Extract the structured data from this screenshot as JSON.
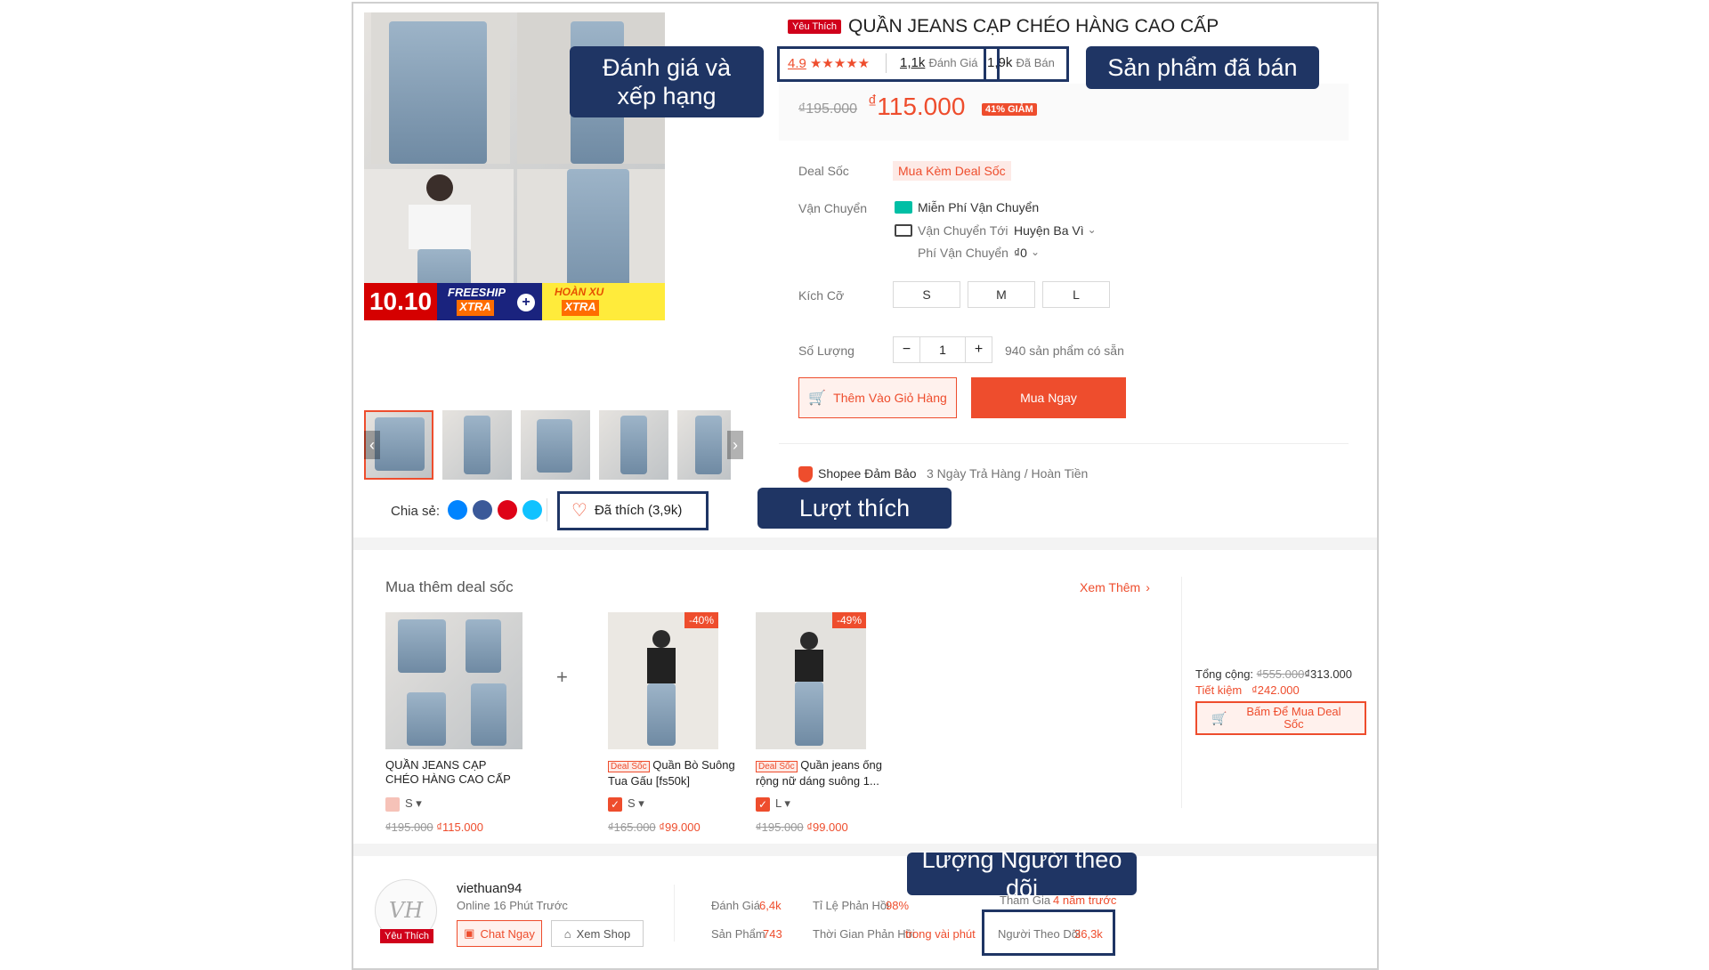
{
  "product": {
    "badge": "Yêu Thích",
    "title": "QUẦN JEANS CẠP CHÉO HÀNG CAO CẤP",
    "rating": "4.9",
    "stars": "★★★★★",
    "reviews_count": "1,1k",
    "reviews_label": "Đánh Giá",
    "sold_count": "1,9k",
    "sold_label": "Đã Bán",
    "old_price": "₫195.000",
    "currency": "₫",
    "price": "115.000",
    "discount": "41% GIẢM"
  },
  "details": {
    "deal_label": "Deal Sốc",
    "deal_value": "Mua Kèm Deal Sốc",
    "shipping_label": "Vận Chuyển",
    "free_ship": "Miễn Phí Vận Chuyển",
    "ship_to_label": "Vận Chuyển Tới",
    "ship_to_value": "Huyện Ba Vì",
    "ship_fee_label": "Phí Vận Chuyển",
    "ship_fee_value": "₫0",
    "size_label": "Kích Cỡ",
    "sizes": [
      "S",
      "M",
      "L"
    ],
    "qty_label": "Số Lượng",
    "qty_minus": "−",
    "qty_value": "1",
    "qty_plus": "+",
    "stock": "940 sản phẩm có sẵn",
    "add_cart": "Thêm Vào Giỏ Hàng",
    "buy_now": "Mua Ngay",
    "guarantee": "Shopee Đảm Bảo",
    "guarantee_note": "3 Ngày Trả Hàng / Hoàn Tiền"
  },
  "banner": {
    "sale": "10.10",
    "freeship": "FREESHIP",
    "xtra": "XTRA",
    "hoanxu": "HOÀN XU",
    "xtra2": "XTRA"
  },
  "share": {
    "label": "Chia sẻ:",
    "liked": "Đã thích (3,9k)"
  },
  "annotations": {
    "rating_line1": "Đánh giá và",
    "rating_line2": "xếp hạng",
    "sold": "Sản phẩm đã bán",
    "likes": "Lượt thích",
    "followers": "Lượng Người theo dõi"
  },
  "deals": {
    "title": "Mua thêm deal sốc",
    "see_more": "Xem Thêm",
    "plus": "+",
    "items": [
      {
        "name1": "QUẦN JEANS CẠP",
        "name2": "CHÉO HÀNG CAO CẤP",
        "tag": "",
        "size": "S",
        "old": "₫195.000",
        "price": "₫115.000",
        "badge": ""
      },
      {
        "name1": "Quần Bò Suông",
        "name2": "Tua Gấu [fs50k]",
        "tag": "Deal Sốc",
        "size": "S",
        "old": "₫165.000",
        "price": "₫99.000",
        "badge": "-40%"
      },
      {
        "name1": "Quần jeans ống",
        "name2": "rộng nữ dáng suông 1...",
        "tag": "Deal Sốc",
        "size": "L",
        "old": "₫195.000",
        "price": "₫99.000",
        "badge": "-49%"
      }
    ],
    "total_label": "Tổng cộng:",
    "total_old": "₫555.000",
    "total_new": "₫313.000",
    "save_label": "Tiết kiệm",
    "save_value": "₫242.000",
    "buy_deal_line1": "Bấm Để Mua Deal",
    "buy_deal_line2": "Sốc"
  },
  "shop": {
    "avatar_text": "VH",
    "badge": "Yêu Thích",
    "name": "viethuan94",
    "online": "Online 16 Phút Trước",
    "chat": "Chat Ngay",
    "view": "Xem Shop",
    "reviews_label": "Đánh Giá",
    "reviews_value": "6,4k",
    "products_label": "Sản Phẩm",
    "products_value": "743",
    "reply_rate_label": "Tỉ Lệ Phản Hồi",
    "reply_rate_value": "98%",
    "reply_time_label": "Thời Gian Phản Hồi",
    "reply_time_value": "trong vài phút",
    "joined_label": "Tham Gia",
    "joined_value": "4 năm trước",
    "followers_label": "Người Theo Dõi",
    "followers_value": "36,3k"
  }
}
